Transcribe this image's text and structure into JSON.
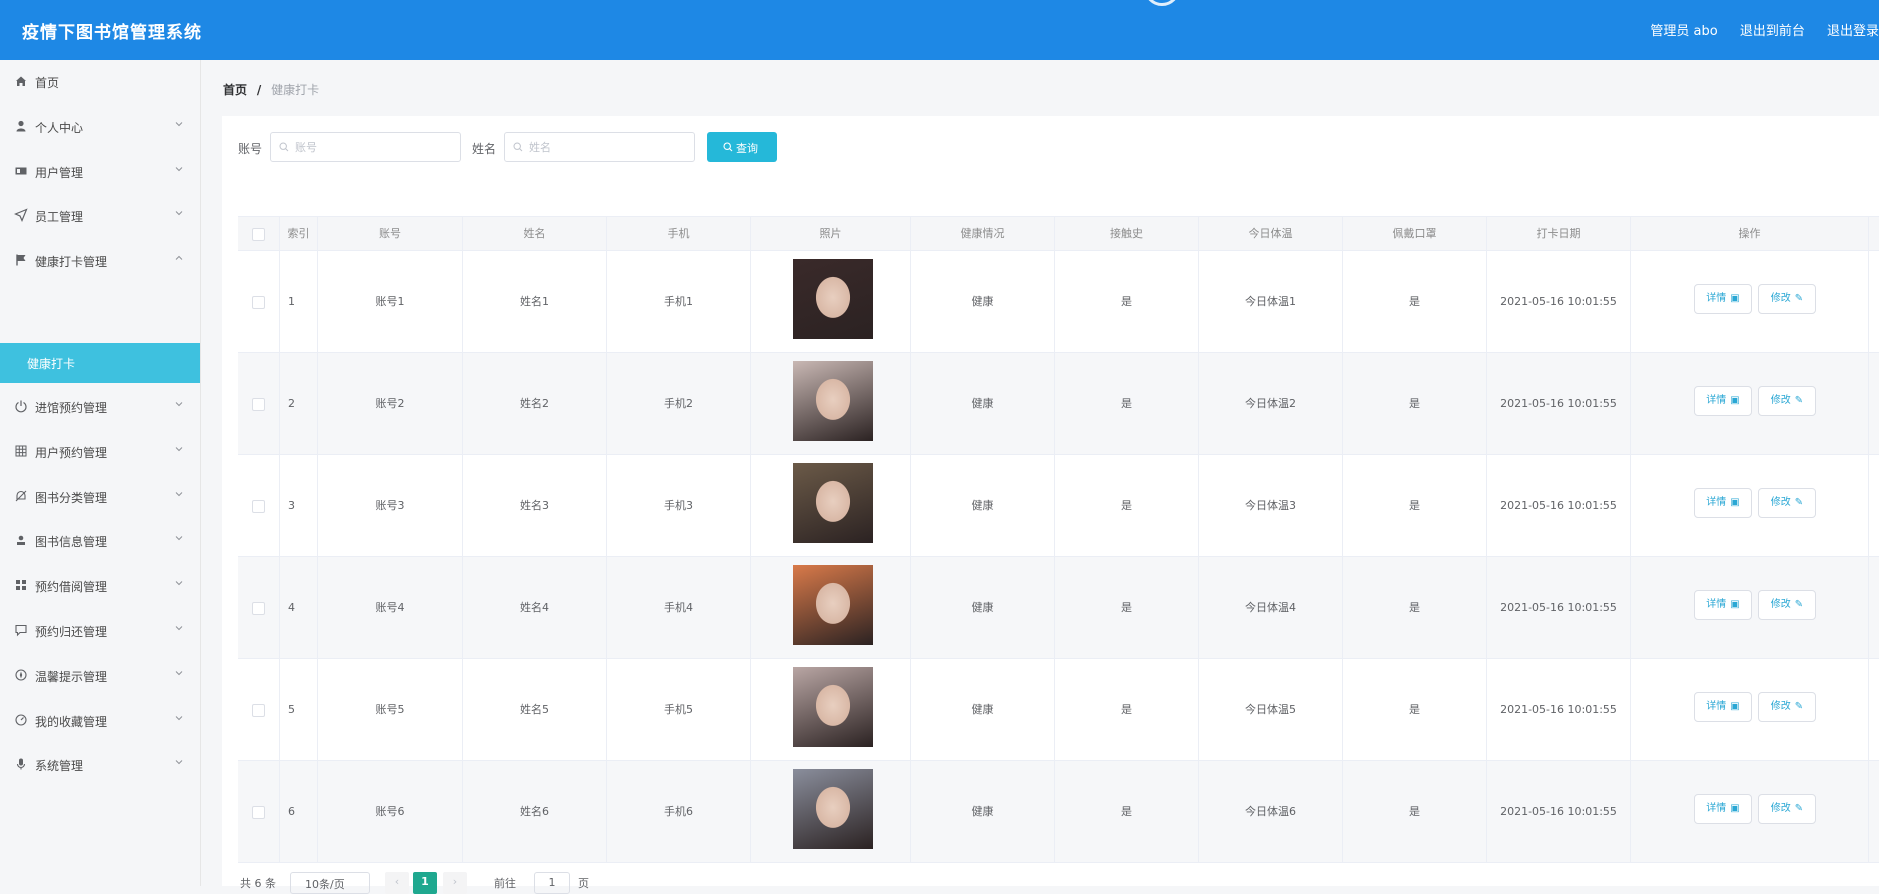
{
  "header": {
    "title": "疫情下图书馆管理系统",
    "admin": "管理员 abo",
    "to_front": "退出到前台",
    "logout": "退出登录"
  },
  "sidebar": {
    "items": [
      {
        "label": "首页",
        "icon": "home-icon"
      },
      {
        "label": "个人中心",
        "icon": "user-icon"
      },
      {
        "label": "用户管理",
        "icon": "users-icon"
      },
      {
        "label": "员工管理",
        "icon": "send-icon"
      },
      {
        "label": "健康打卡管理",
        "icon": "flag-icon",
        "expanded": true
      },
      {
        "label": "进馆预约管理",
        "icon": "power-icon"
      },
      {
        "label": "用户预约管理",
        "icon": "grid-icon"
      },
      {
        "label": "图书分类管理",
        "icon": "bell-icon"
      },
      {
        "label": "图书信息管理",
        "icon": "person-icon"
      },
      {
        "label": "预约借阅管理",
        "icon": "apps-icon"
      },
      {
        "label": "预约归还管理",
        "icon": "chat-icon"
      },
      {
        "label": "温馨提示管理",
        "icon": "compass-icon"
      },
      {
        "label": "我的收藏管理",
        "icon": "gauge-icon"
      },
      {
        "label": "系统管理",
        "icon": "mic-icon"
      }
    ],
    "active_sub": "健康打卡"
  },
  "breadcrumb": {
    "home": "首页",
    "separator": "/",
    "current": "健康打卡"
  },
  "search": {
    "account_label": "账号",
    "account_placeholder": "账号",
    "name_label": "姓名",
    "name_placeholder": "姓名",
    "query_button": "查询"
  },
  "table": {
    "headers": [
      "索引",
      "账号",
      "姓名",
      "手机",
      "照片",
      "健康情况",
      "接触史",
      "今日体温",
      "佩戴口罩",
      "打卡日期",
      "操作"
    ],
    "rows": [
      {
        "index": "1",
        "account": "账号1",
        "name": "姓名1",
        "phone": "手机1",
        "health": "健康",
        "contact": "是",
        "temp": "今日体温1",
        "mask": "是",
        "date": "2021-05-16 10:01:55"
      },
      {
        "index": "2",
        "account": "账号2",
        "name": "姓名2",
        "phone": "手机2",
        "health": "健康",
        "contact": "是",
        "temp": "今日体温2",
        "mask": "是",
        "date": "2021-05-16 10:01:55"
      },
      {
        "index": "3",
        "account": "账号3",
        "name": "姓名3",
        "phone": "手机3",
        "health": "健康",
        "contact": "是",
        "temp": "今日体温3",
        "mask": "是",
        "date": "2021-05-16 10:01:55"
      },
      {
        "index": "4",
        "account": "账号4",
        "name": "姓名4",
        "phone": "手机4",
        "health": "健康",
        "contact": "是",
        "temp": "今日体温4",
        "mask": "是",
        "date": "2021-05-16 10:01:55"
      },
      {
        "index": "5",
        "account": "账号5",
        "name": "姓名5",
        "phone": "手机5",
        "health": "健康",
        "contact": "是",
        "temp": "今日体温5",
        "mask": "是",
        "date": "2021-05-16 10:01:55"
      },
      {
        "index": "6",
        "account": "账号6",
        "name": "姓名6",
        "phone": "手机6",
        "health": "健康",
        "contact": "是",
        "temp": "今日体温6",
        "mask": "是",
        "date": "2021-05-16 10:01:55"
      }
    ],
    "detail_button": "详情",
    "edit_button": "修改",
    "photo_colors": [
      "#3a2a2a",
      "#c9b8b4",
      "#6b5a48",
      "#d97a4a",
      "#b9a6a4",
      "#8a8e9c"
    ]
  },
  "pagination": {
    "total": "共 6 条",
    "page_size": "10条/页",
    "current_page": "1",
    "goto_label": "前往",
    "goto_value": "1",
    "page_suffix": "页"
  },
  "colors": {
    "header_bg": "#1e88e5",
    "active_menu": "#3ec1df",
    "query_button": "#25b8d9",
    "page_active": "#1fa88f"
  }
}
